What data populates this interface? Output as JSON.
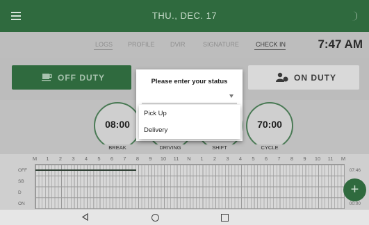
{
  "header": {
    "date": "THU., DEC. 17",
    "menu_icon": "hamburger-menu-icon",
    "theme_icon": "moon-icon"
  },
  "tabs": [
    {
      "label": "LOGS",
      "active": false
    },
    {
      "label": "PROFILE",
      "active": false
    },
    {
      "label": "DVIR",
      "active": false
    },
    {
      "label": "SIGNATURE",
      "active": false
    },
    {
      "label": "CHECK IN",
      "active": true
    }
  ],
  "clock": "7:47 AM",
  "status_buttons": {
    "off_duty": "OFF DUTY",
    "on_duty": "ON DUTY",
    "off_icon": "coffee-cup-icon",
    "on_icon": "driver-user-icon"
  },
  "timers": [
    {
      "value": "08:00",
      "label": "BREAK"
    },
    {
      "value": "",
      "label": "DRIVING"
    },
    {
      "value": "",
      "label": "SHIFT"
    },
    {
      "value": "70:00",
      "label": "CYCLE"
    }
  ],
  "log_grid": {
    "hours": [
      "M",
      "1",
      "2",
      "3",
      "4",
      "5",
      "6",
      "7",
      "8",
      "9",
      "10",
      "11",
      "N",
      "1",
      "2",
      "3",
      "4",
      "5",
      "6",
      "7",
      "8",
      "9",
      "10",
      "11",
      "M"
    ],
    "rows": [
      "OFF",
      "SB",
      "D",
      "ON"
    ],
    "right_times": [
      "07:46",
      "",
      "",
      "00:00"
    ]
  },
  "fab_label": "+",
  "dialog": {
    "title": "Please enter your status",
    "select_value": "",
    "options": [
      "Pick Up",
      "Delivery"
    ]
  },
  "colors": {
    "brand_green": "#2f6a3e",
    "overlay_gray": "#bdbdbd"
  }
}
